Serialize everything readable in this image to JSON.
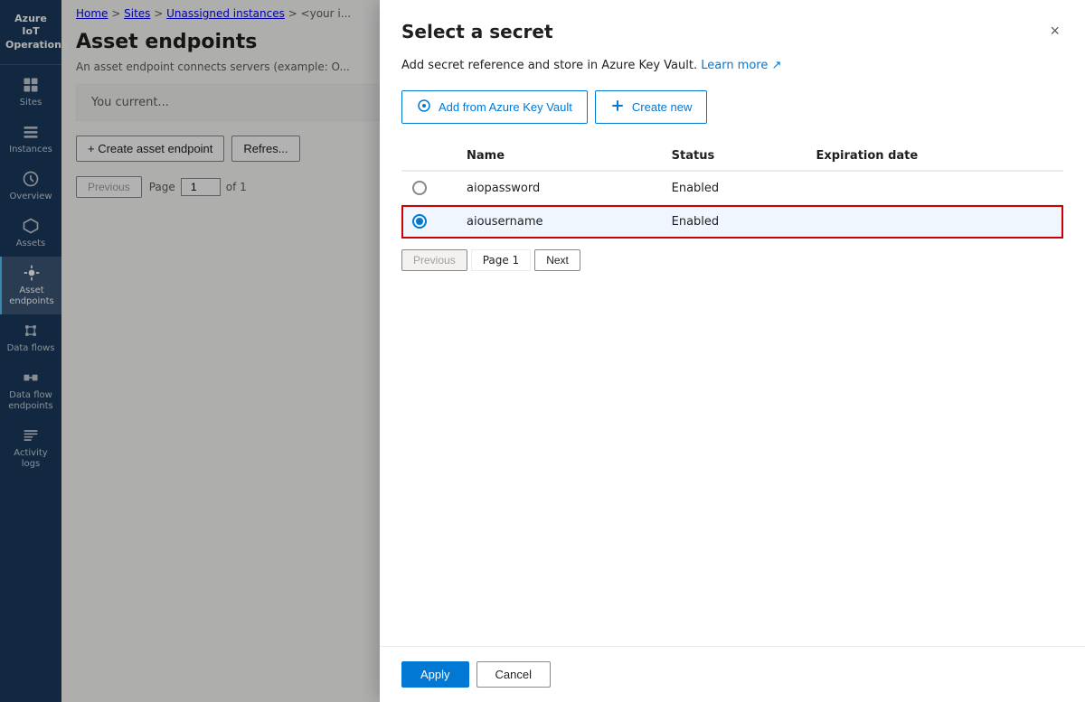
{
  "app": {
    "name": "Azure IoT Operations"
  },
  "sidebar": {
    "items": [
      {
        "id": "sites",
        "label": "Sites"
      },
      {
        "id": "instances",
        "label": "Instances"
      },
      {
        "id": "overview",
        "label": "Overview"
      },
      {
        "id": "assets",
        "label": "Assets"
      },
      {
        "id": "asset-endpoints",
        "label": "Asset endpoints",
        "active": true
      },
      {
        "id": "data-flows",
        "label": "Data flows"
      },
      {
        "id": "data-flow-endpoints",
        "label": "Data flow endpoints"
      },
      {
        "id": "activity-logs",
        "label": "Activity logs"
      }
    ]
  },
  "breadcrumb": {
    "parts": [
      "Home",
      "Sites",
      "Unassigned instances",
      "<your i..."
    ]
  },
  "page": {
    "title": "Asset endpoints",
    "subtitle": "An asset endpoint connects servers (example: O..."
  },
  "content": {
    "notice": "You current...",
    "toolbar": {
      "create_label": "+ Create asset endpoint",
      "refresh_label": "Refres..."
    },
    "pagination": {
      "previous_label": "Previous",
      "page_label": "Page",
      "page_value": "1",
      "of_label": "of 1"
    }
  },
  "dialog": {
    "title": "Select a secret",
    "description": "Add secret reference and store in Azure Key Vault.",
    "learn_more": "Learn more",
    "close_icon": "×",
    "add_from_vault_label": "Add from Azure Key Vault",
    "create_new_label": "Create new",
    "table": {
      "columns": [
        "Name",
        "Status",
        "Expiration date"
      ],
      "rows": [
        {
          "id": "row1",
          "name": "aiopassword",
          "status": "Enabled",
          "expiration": "",
          "selected": false
        },
        {
          "id": "row2",
          "name": "aiousername",
          "status": "Enabled",
          "expiration": "",
          "selected": true
        }
      ]
    },
    "pagination": {
      "previous_label": "Previous",
      "page_label": "Page 1",
      "next_label": "Next"
    },
    "footer": {
      "apply_label": "Apply",
      "cancel_label": "Cancel"
    }
  }
}
